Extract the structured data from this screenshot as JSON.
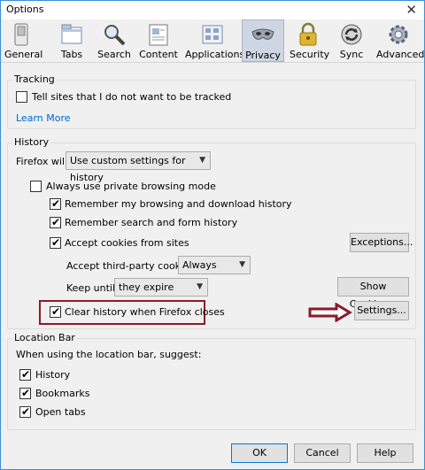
{
  "window": {
    "title": "Options",
    "close_glyph": "✕"
  },
  "toolbar": {
    "items": [
      {
        "label": "General"
      },
      {
        "label": "Tabs"
      },
      {
        "label": "Search"
      },
      {
        "label": "Content"
      },
      {
        "label": "Applications"
      },
      {
        "label": "Privacy",
        "active": true
      },
      {
        "label": "Security"
      },
      {
        "label": "Sync"
      },
      {
        "label": "Advanced"
      }
    ]
  },
  "tracking": {
    "group_title": "Tracking",
    "dnt_label": "Tell sites that I do not want to be tracked",
    "dnt_checked": false,
    "learn_more": "Learn More"
  },
  "history": {
    "group_title": "History",
    "firefox_will_label": "Firefox will:",
    "mode_value": "Use custom settings for history",
    "private_mode_label": "Always use private browsing mode",
    "private_mode_checked": false,
    "remember_browsing_label": "Remember my browsing and download history",
    "remember_browsing_checked": true,
    "remember_search_label": "Remember search and form history",
    "remember_search_checked": true,
    "accept_cookies_label": "Accept cookies from sites",
    "accept_cookies_checked": true,
    "exceptions_button": "Exceptions...",
    "third_party_label": "Accept third-party cookies:",
    "third_party_value": "Always",
    "keep_until_label": "Keep until:",
    "keep_until_value": "they expire",
    "show_cookies_button": "Show Cookies...",
    "clear_history_label": "Clear history when Firefox closes",
    "clear_history_checked": true,
    "settings_button": "Settings..."
  },
  "location_bar": {
    "group_title": "Location Bar",
    "suggest_label": "When using the location bar, suggest:",
    "history_label": "History",
    "history_checked": true,
    "bookmarks_label": "Bookmarks",
    "bookmarks_checked": true,
    "open_tabs_label": "Open tabs",
    "open_tabs_checked": true
  },
  "footer": {
    "ok": "OK",
    "cancel": "Cancel",
    "help": "Help"
  },
  "annotation": {
    "highlight_color": "#8b1a2a"
  }
}
